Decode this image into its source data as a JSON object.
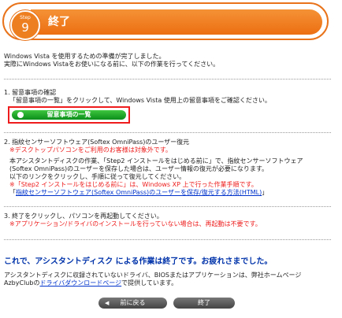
{
  "header": {
    "step_label": "Step",
    "step_number": "9",
    "title": "終了"
  },
  "intro": {
    "line1": "Windows Vista を使用するための準備が完了しました。",
    "line2": "実際にWindows Vistaをお使いになる前に、以下の作業を行ってください。"
  },
  "section1": {
    "heading": "1. 留意事項の確認",
    "text": "「留意事項の一覧」をクリックして、Windows Vista 使用上の留意事項をご確認ください。",
    "button_label": "留意事項の一覧"
  },
  "section2": {
    "heading": "2. 指紋センサーソフトウェア(Softex OmniPass)のユーザー復元",
    "note": "※デスクトップパソコンをご利用のお客様は対象外です。",
    "line1": "本アシスタントディスクの作業、「Step2 インストールをはじめる前に」で、指紋センサーソフトウェア",
    "line2": "(Softex OmniPass)のユーザーを保存した場合は、ユーザー情報の復元が必要になります。",
    "line3": "以下のリンクをクリックし、手順に従って復元してください。",
    "note2": "※「Step2 インストールをはじめる前に」は、Windows XP 上で行った作業手順です。",
    "link_open": "「",
    "link": "指紋センサーソフトウェア(Softex OmniPass)のユーザーを保存/復元する方法(HTML)",
    "link_close": "」"
  },
  "section3": {
    "heading": "3. 終了をクリックし、パソコンを再起動してください。",
    "note": "※アプリケーション/ドライバのインストールを行っていない場合は、再起動は不要です。"
  },
  "closing": "これで、アシスタントディスク による作業は終了です。お疲れさまでした。",
  "footer": {
    "line1": "アシスタントディスクに収録されていないドライバ、BIOSまたはアプリケーションは、弊社ホームページ",
    "line2_pre": "AzbyClubの",
    "line2_link": "ドライバダウンロードページ",
    "line2_post": "で提供しています。"
  },
  "nav": {
    "back_label": "前に戻る",
    "end_label": "終了"
  }
}
